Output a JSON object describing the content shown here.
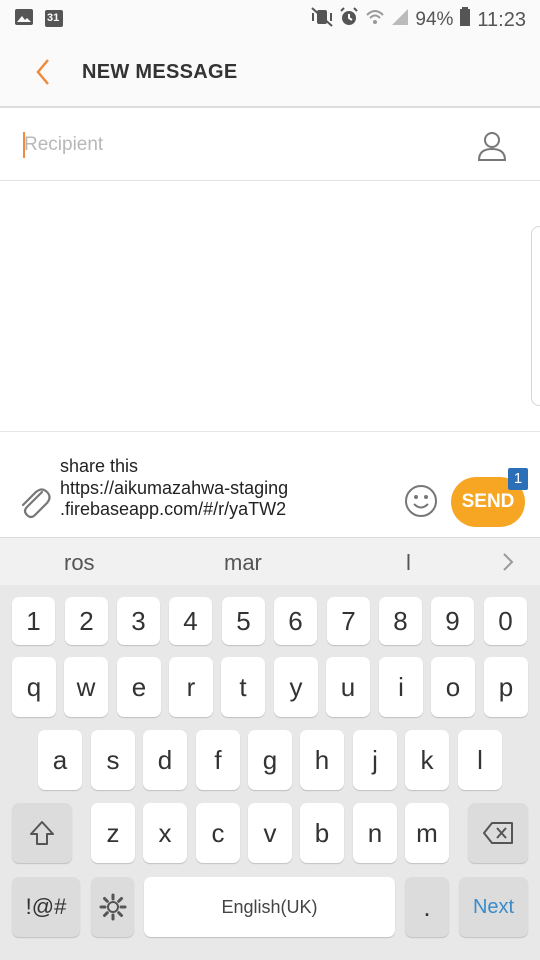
{
  "status_bar": {
    "left_icons": [
      "gallery-icon",
      "calendar-icon"
    ],
    "calendar_day": "31",
    "right_icons": [
      "mute-vibrate-icon",
      "alarm-icon",
      "wifi-icon",
      "signal-icon"
    ],
    "battery": "94%",
    "time": "11:23"
  },
  "app_bar": {
    "back_icon": "chevron-left-icon",
    "title": "NEW MESSAGE"
  },
  "recipient": {
    "placeholder": "Recipient",
    "contact_icon": "contact-person-icon"
  },
  "composer": {
    "attach_icon": "paperclip-icon",
    "message_lines": [
      "share this",
      "https://aikumazahwa-staging",
      ".firebaseapp.com/#/r/yaTW2"
    ],
    "emoji_icon": "smiley-icon",
    "send_label": "SEND",
    "send_badge": "1"
  },
  "suggestions": {
    "items": [
      "ros",
      "mar",
      "l"
    ],
    "arrow_icon": "chevron-right-icon"
  },
  "keyboard": {
    "number_row": [
      "1",
      "2",
      "3",
      "4",
      "5",
      "6",
      "7",
      "8",
      "9",
      "0"
    ],
    "row1": [
      "q",
      "w",
      "e",
      "r",
      "t",
      "y",
      "u",
      "i",
      "o",
      "p"
    ],
    "row2": [
      "a",
      "s",
      "d",
      "f",
      "g",
      "h",
      "j",
      "k",
      "l"
    ],
    "row3": [
      "z",
      "x",
      "c",
      "v",
      "b",
      "n",
      "m"
    ],
    "shift_icon": "shift-arrow-icon",
    "backspace_icon": "backspace-icon",
    "symbols_label": "!@#",
    "settings_icon": "gear-icon",
    "space_label": "English(UK)",
    "period_label": ".",
    "next_label": "Next"
  },
  "colors": {
    "accent": "#f6a623",
    "back_arrow": "#f08a3c",
    "badge": "#2b6fb8",
    "next_text": "#3a8bc9"
  }
}
